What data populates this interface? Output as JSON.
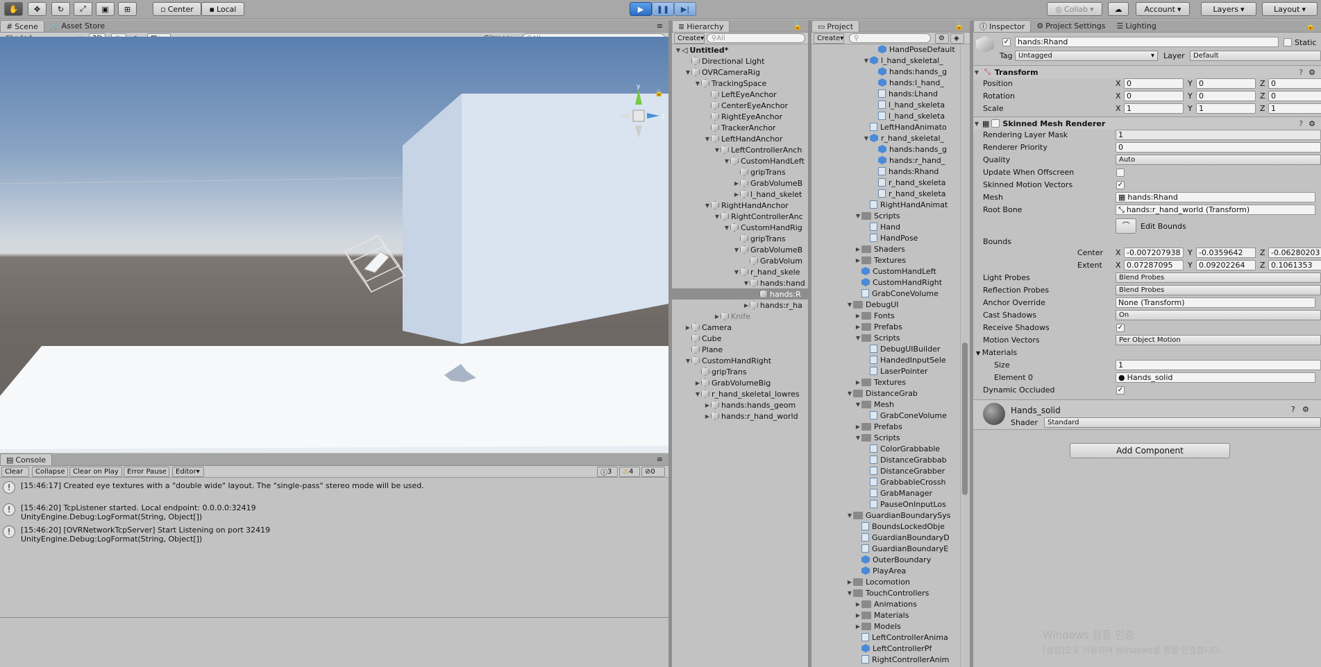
{
  "toolbar": {
    "tools": [
      "hand-tool",
      "move-tool",
      "rotate-tool",
      "scale-tool",
      "rect-tool",
      "transform-tool"
    ],
    "pivot": "Center",
    "space": "Local",
    "collab": "Collab",
    "account": "Account",
    "layers": "Layers",
    "layout": "Layout"
  },
  "scene": {
    "tabs": [
      "Scene",
      "Asset Store"
    ],
    "shading": "Shaded",
    "mode_2d": "2D",
    "gizmos": "Gizmos",
    "search_placeholder": "All",
    "gizmo_axes": {
      "y": "y",
      "z": "z"
    }
  },
  "console": {
    "tab": "Console",
    "buttons": [
      "Clear",
      "Collapse",
      "Clear on Play",
      "Error Pause",
      "Editor"
    ],
    "counts": {
      "info": "3",
      "warn": "4",
      "error": "0"
    },
    "messages": [
      {
        "line1": "[15:46:17] Created eye textures with a \"double wide\" layout.  The \"single-pass\" stereo mode will be used.",
        "line2": ""
      },
      {
        "line1": "[15:46:20] TcpListener started. Local endpoint: 0.0.0.0:32419",
        "line2": "UnityEngine.Debug:LogFormat(String, Object[])"
      },
      {
        "line1": "[15:46:20] [OVRNetworkTcpServer] Start Listening on port 32419",
        "line2": "UnityEngine.Debug:LogFormat(String, Object[])"
      }
    ]
  },
  "hierarchy": {
    "tab": "Hierarchy",
    "create": "Create",
    "search_placeholder": "All",
    "scene_name": "Untitled*",
    "items": [
      {
        "label": "Directional Light",
        "depth": 1,
        "arrow": ""
      },
      {
        "label": "OVRCameraRig",
        "depth": 1,
        "arrow": "down"
      },
      {
        "label": "TrackingSpace",
        "depth": 2,
        "arrow": "down"
      },
      {
        "label": "LeftEyeAnchor",
        "depth": 3,
        "arrow": ""
      },
      {
        "label": "CenterEyeAnchor",
        "depth": 3,
        "arrow": ""
      },
      {
        "label": "RightEyeAnchor",
        "depth": 3,
        "arrow": ""
      },
      {
        "label": "TrackerAnchor",
        "depth": 3,
        "arrow": ""
      },
      {
        "label": "LeftHandAnchor",
        "depth": 3,
        "arrow": "down"
      },
      {
        "label": "LeftControllerAnch",
        "depth": 4,
        "arrow": "down"
      },
      {
        "label": "CustomHandLeft",
        "depth": 5,
        "arrow": "down"
      },
      {
        "label": "gripTrans",
        "depth": 6,
        "arrow": ""
      },
      {
        "label": "GrabVolumeB",
        "depth": 6,
        "arrow": "right"
      },
      {
        "label": "l_hand_skelet",
        "depth": 6,
        "arrow": "right"
      },
      {
        "label": "RightHandAnchor",
        "depth": 3,
        "arrow": "down"
      },
      {
        "label": "RightControllerAnc",
        "depth": 4,
        "arrow": "down"
      },
      {
        "label": "CustomHandRig",
        "depth": 5,
        "arrow": "down"
      },
      {
        "label": "gripTrans",
        "depth": 6,
        "arrow": ""
      },
      {
        "label": "GrabVolumeB",
        "depth": 6,
        "arrow": "down"
      },
      {
        "label": "GrabVolum",
        "depth": 7,
        "arrow": ""
      },
      {
        "label": "r_hand_skele",
        "depth": 6,
        "arrow": "down"
      },
      {
        "label": "hands:hand",
        "depth": 7,
        "arrow": "down"
      },
      {
        "label": "hands:R",
        "depth": 8,
        "arrow": "",
        "selected": true
      },
      {
        "label": "hands:r_ha",
        "depth": 7,
        "arrow": "right"
      },
      {
        "label": "Knife",
        "depth": 4,
        "arrow": "right",
        "dim": true
      },
      {
        "label": "Camera",
        "depth": 1,
        "arrow": "right"
      },
      {
        "label": "Cube",
        "depth": 1,
        "arrow": ""
      },
      {
        "label": "Plane",
        "depth": 1,
        "arrow": ""
      },
      {
        "label": "CustomHandRight",
        "depth": 1,
        "arrow": "down"
      },
      {
        "label": "gripTrans",
        "depth": 2,
        "arrow": ""
      },
      {
        "label": "GrabVolumeBig",
        "depth": 2,
        "arrow": "right"
      },
      {
        "label": "r_hand_skeletal_lowres",
        "depth": 2,
        "arrow": "down"
      },
      {
        "label": "hands:hands_geom",
        "depth": 3,
        "arrow": "right"
      },
      {
        "label": "hands:r_hand_world",
        "depth": 3,
        "arrow": "right"
      }
    ]
  },
  "project": {
    "tab": "Project",
    "create": "Create",
    "items": [
      {
        "label": "HandPoseDefault",
        "depth": 4,
        "arrow": "",
        "icon": "prefab"
      },
      {
        "label": "l_hand_skeletal_",
        "depth": 3,
        "arrow": "down",
        "icon": "prefab"
      },
      {
        "label": "hands:hands_g",
        "depth": 4,
        "arrow": "",
        "icon": "prefab"
      },
      {
        "label": "hands:l_hand_",
        "depth": 4,
        "arrow": "",
        "icon": "prefab"
      },
      {
        "label": "hands:Lhand",
        "depth": 4,
        "arrow": "",
        "icon": "mesh"
      },
      {
        "label": "l_hand_skeleta",
        "depth": 4,
        "arrow": "",
        "icon": "anim"
      },
      {
        "label": "l_hand_skeleta",
        "depth": 4,
        "arrow": "",
        "icon": "avatar"
      },
      {
        "label": "LeftHandAnimato",
        "depth": 3,
        "arrow": "",
        "icon": "mesh"
      },
      {
        "label": "r_hand_skeletal_",
        "depth": 3,
        "arrow": "down",
        "icon": "prefab"
      },
      {
        "label": "hands:hands_g",
        "depth": 4,
        "arrow": "",
        "icon": "prefab"
      },
      {
        "label": "hands:r_hand_",
        "depth": 4,
        "arrow": "",
        "icon": "prefab"
      },
      {
        "label": "hands:Rhand",
        "depth": 4,
        "arrow": "",
        "icon": "mesh"
      },
      {
        "label": "r_hand_skeleta",
        "depth": 4,
        "arrow": "",
        "icon": "anim"
      },
      {
        "label": "r_hand_skeleta",
        "depth": 4,
        "arrow": "",
        "icon": "avatar"
      },
      {
        "label": "RightHandAnimat",
        "depth": 3,
        "arrow": "",
        "icon": "mesh"
      },
      {
        "label": "Scripts",
        "depth": 2,
        "arrow": "down",
        "icon": "folder"
      },
      {
        "label": "Hand",
        "depth": 3,
        "arrow": "",
        "icon": "script"
      },
      {
        "label": "HandPose",
        "depth": 3,
        "arrow": "",
        "icon": "script"
      },
      {
        "label": "Shaders",
        "depth": 2,
        "arrow": "right",
        "icon": "folder"
      },
      {
        "label": "Textures",
        "depth": 2,
        "arrow": "right",
        "icon": "folder"
      },
      {
        "label": "CustomHandLeft",
        "depth": 2,
        "arrow": "",
        "icon": "prefab"
      },
      {
        "label": "CustomHandRight",
        "depth": 2,
        "arrow": "",
        "icon": "prefab"
      },
      {
        "label": "GrabConeVolume",
        "depth": 2,
        "arrow": "",
        "icon": "mesh"
      },
      {
        "label": "DebugUI",
        "depth": 1,
        "arrow": "down",
        "icon": "folder"
      },
      {
        "label": "Fonts",
        "depth": 2,
        "arrow": "right",
        "icon": "folder"
      },
      {
        "label": "Prefabs",
        "depth": 2,
        "arrow": "right",
        "icon": "folder"
      },
      {
        "label": "Scripts",
        "depth": 2,
        "arrow": "down",
        "icon": "folder"
      },
      {
        "label": "DebugUIBuilder",
        "depth": 3,
        "arrow": "",
        "icon": "script"
      },
      {
        "label": "HandedInputSele",
        "depth": 3,
        "arrow": "",
        "icon": "script"
      },
      {
        "label": "LaserPointer",
        "depth": 3,
        "arrow": "",
        "icon": "script"
      },
      {
        "label": "Textures",
        "depth": 2,
        "arrow": "right",
        "icon": "folder"
      },
      {
        "label": "DistanceGrab",
        "depth": 1,
        "arrow": "down",
        "icon": "folder"
      },
      {
        "label": "Mesh",
        "depth": 2,
        "arrow": "down",
        "icon": "folder"
      },
      {
        "label": "GrabConeVolume",
        "depth": 3,
        "arrow": "",
        "icon": "mesh"
      },
      {
        "label": "Prefabs",
        "depth": 2,
        "arrow": "right",
        "icon": "folder"
      },
      {
        "label": "Scripts",
        "depth": 2,
        "arrow": "down",
        "icon": "folder"
      },
      {
        "label": "ColorGrabbable",
        "depth": 3,
        "arrow": "",
        "icon": "script"
      },
      {
        "label": "DistanceGrabbab",
        "depth": 3,
        "arrow": "",
        "icon": "script"
      },
      {
        "label": "DistanceGrabber",
        "depth": 3,
        "arrow": "",
        "icon": "script"
      },
      {
        "label": "GrabbableCrossh",
        "depth": 3,
        "arrow": "",
        "icon": "script"
      },
      {
        "label": "GrabManager",
        "depth": 3,
        "arrow": "",
        "icon": "script"
      },
      {
        "label": "PauseOnInputLos",
        "depth": 3,
        "arrow": "",
        "icon": "script"
      },
      {
        "label": "GuardianBoundarySys",
        "depth": 1,
        "arrow": "down",
        "icon": "folder"
      },
      {
        "label": "BoundsLockedObje",
        "depth": 2,
        "arrow": "",
        "icon": "script"
      },
      {
        "label": "GuardianBoundaryD",
        "depth": 2,
        "arrow": "",
        "icon": "script"
      },
      {
        "label": "GuardianBoundaryE",
        "depth": 2,
        "arrow": "",
        "icon": "script"
      },
      {
        "label": "OuterBoundary",
        "depth": 2,
        "arrow": "",
        "icon": "prefab"
      },
      {
        "label": "PlayArea",
        "depth": 2,
        "arrow": "",
        "icon": "prefab"
      },
      {
        "label": "Locomotion",
        "depth": 1,
        "arrow": "right",
        "icon": "folder"
      },
      {
        "label": "TouchControllers",
        "depth": 1,
        "arrow": "down",
        "icon": "folder"
      },
      {
        "label": "Animations",
        "depth": 2,
        "arrow": "right",
        "icon": "folder"
      },
      {
        "label": "Materials",
        "depth": 2,
        "arrow": "right",
        "icon": "folder"
      },
      {
        "label": "Models",
        "depth": 2,
        "arrow": "right",
        "icon": "folder"
      },
      {
        "label": "LeftControllerAnima",
        "depth": 2,
        "arrow": "",
        "icon": "mesh"
      },
      {
        "label": "LeftControllerPf",
        "depth": 2,
        "arrow": "",
        "icon": "prefab"
      },
      {
        "label": "RightControllerAnim",
        "depth": 2,
        "arrow": "",
        "icon": "mesh"
      }
    ]
  },
  "inspector": {
    "tabs": [
      "Inspector",
      "Project Settings",
      "Lighting"
    ],
    "object_name": "hands:Rhand",
    "static_label": "Static",
    "tag_label": "Tag",
    "tag_value": "Untagged",
    "layer_label": "Layer",
    "layer_value": "Default",
    "transform": {
      "title": "Transform",
      "rows": [
        {
          "label": "Position",
          "x": "0",
          "y": "0",
          "z": "0"
        },
        {
          "label": "Rotation",
          "x": "0",
          "y": "0",
          "z": "0"
        },
        {
          "label": "Scale",
          "x": "1",
          "y": "1",
          "z": "1"
        }
      ]
    },
    "smr": {
      "title": "Skinned Mesh Renderer",
      "rendering_layer_mask": {
        "label": "Rendering Layer Mask",
        "value": "1"
      },
      "renderer_priority": {
        "label": "Renderer Priority",
        "value": "0"
      },
      "quality": {
        "label": "Quality",
        "value": "Auto"
      },
      "update_offscreen": {
        "label": "Update When Offscreen",
        "checked": false
      },
      "skinned_motion": {
        "label": "Skinned Motion Vectors",
        "checked": true
      },
      "mesh": {
        "label": "Mesh",
        "value": "hands:Rhand"
      },
      "root_bone": {
        "label": "Root Bone",
        "value": "hands:r_hand_world (Transform)"
      },
      "edit_bounds": "Edit Bounds",
      "bounds_label": "Bounds",
      "center": {
        "label": "Center",
        "x": "-0.007207938",
        "y": "-0.0359642",
        "z": "-0.06280203"
      },
      "extent": {
        "label": "Extent",
        "x": "0.07287095",
        "y": "0.09202264",
        "z": "0.1061353"
      },
      "light_probes": {
        "label": "Light Probes",
        "value": "Blend Probes"
      },
      "reflection_probes": {
        "label": "Reflection Probes",
        "value": "Blend Probes"
      },
      "anchor_override": {
        "label": "Anchor Override",
        "value": "None (Transform)"
      },
      "cast_shadows": {
        "label": "Cast Shadows",
        "value": "On"
      },
      "receive_shadows": {
        "label": "Receive Shadows",
        "checked": true
      },
      "motion_vectors": {
        "label": "Motion Vectors",
        "value": "Per Object Motion"
      },
      "materials_label": "Materials",
      "size": {
        "label": "Size",
        "value": "1"
      },
      "element0": {
        "label": "Element 0",
        "value": "Hands_solid"
      },
      "dynamic_occluded": {
        "label": "Dynamic Occluded",
        "checked": true
      }
    },
    "material": {
      "name": "Hands_solid",
      "shader_label": "Shader",
      "shader_value": "Standard"
    },
    "add_component": "Add Component",
    "watermark": {
      "line1": "Windows 정품 인증",
      "line2": "[설정]으로 이동하여 Windows를 정품 인증합니다."
    }
  }
}
